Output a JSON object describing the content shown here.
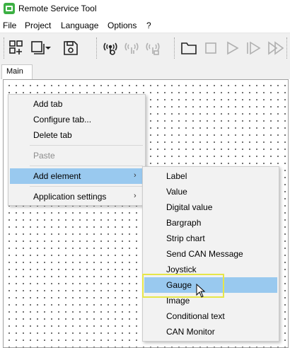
{
  "window": {
    "title": "Remote Service Tool"
  },
  "menubar": {
    "items": [
      "File",
      "Project",
      "Language",
      "Options",
      "?"
    ]
  },
  "toolbar": {
    "icons": [
      "add-grid-icon",
      "window-icon",
      "dropdown-icon",
      "save-icon",
      "connect-icon",
      "signal-icon",
      "disconnect-icon",
      "folder-icon",
      "stop-icon",
      "play-icon",
      "step-icon",
      "fast-forward-icon"
    ]
  },
  "tabs": {
    "main": "Main"
  },
  "context_menu": {
    "add_tab": "Add tab",
    "configure_tab": "Configure tab...",
    "delete_tab": "Delete tab",
    "paste": "Paste",
    "add_element": "Add element",
    "application_settings": "Application settings"
  },
  "submenu": {
    "items": [
      "Label",
      "Value",
      "Digital value",
      "Bargraph",
      "Strip chart",
      "Send CAN Message",
      "Joystick",
      "Gauge",
      "Image",
      "Conditional text",
      "CAN Monitor"
    ],
    "highlighted": "Gauge"
  },
  "colors": {
    "highlight": "#99c9ef",
    "callout": "#e6e64a",
    "app_icon": "#3cb043"
  }
}
